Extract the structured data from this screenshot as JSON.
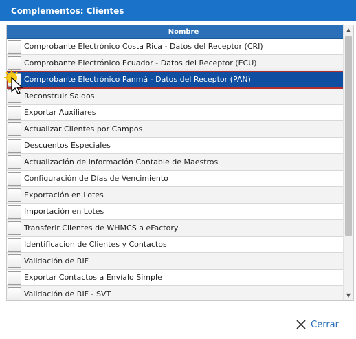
{
  "dialog": {
    "title": "Complementos: Clientes"
  },
  "grid": {
    "column_header": "Nombre",
    "selected_index": 2,
    "rows": [
      {
        "label": "Comprobante Electrónico Costa Rica - Datos del Receptor (CRI)"
      },
      {
        "label": "Comprobante Electrónico Ecuador - Datos del Receptor (ECU)"
      },
      {
        "label": "Comprobante Electrónico Panmá - Datos del Receptor (PAN)"
      },
      {
        "label": "Reconstruir Saldos"
      },
      {
        "label": "Exportar Auxiliares"
      },
      {
        "label": "Actualizar Clientes por Campos"
      },
      {
        "label": "Descuentos Especiales"
      },
      {
        "label": "Actualización de Información Contable de Maestros"
      },
      {
        "label": "Configuración de Días de Vencimiento"
      },
      {
        "label": "Exportación en Lotes"
      },
      {
        "label": "Importación en Lotes"
      },
      {
        "label": "Transferir Clientes de WHMCS a eFactory"
      },
      {
        "label": "Identificacion de Clientes y Contactos"
      },
      {
        "label": "Validación de RIF"
      },
      {
        "label": "Exportar Contactos a Envíalo Simple"
      },
      {
        "label": "Validación de RIF - SVT"
      }
    ]
  },
  "footer": {
    "close_label": "Cerrar",
    "close_icon": "close-x-icon",
    "accent_color": "#2a6fb8"
  },
  "colors": {
    "title_bar": "#1a73c9",
    "header": "#2a6fb8",
    "selected_row": "#0f4ea0",
    "selected_outline": "#b03030"
  }
}
